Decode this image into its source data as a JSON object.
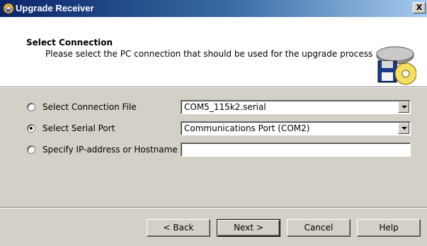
{
  "window": {
    "title": "Upgrade Receiver",
    "close_label": "X"
  },
  "header": {
    "title": "Select Connection",
    "subtitle": "Please select the PC connection that should be used for the upgrade process"
  },
  "options": [
    {
      "label": "Select Connection File",
      "value": "COM5_115k2.serial",
      "selected": false
    },
    {
      "label": "Select Serial Port",
      "value": "Communications Port (COM2)",
      "selected": true
    },
    {
      "label": "Specify IP-address or Hostname",
      "value": "",
      "selected": false
    }
  ],
  "buttons": {
    "back": "< Back",
    "next": "Next >",
    "cancel": "Cancel",
    "help": "Help"
  }
}
